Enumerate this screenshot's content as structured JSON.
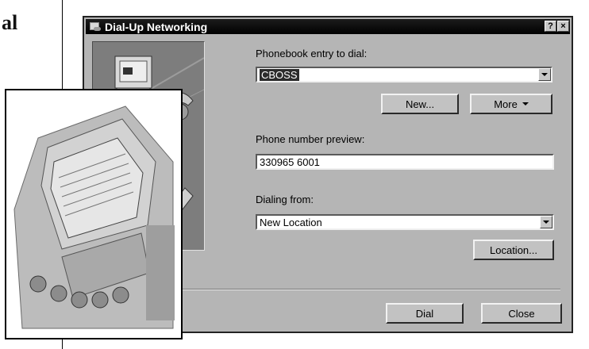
{
  "page": {
    "heading_fragment": "al"
  },
  "dialog": {
    "title": "Dial-Up Networking",
    "help_button": "?",
    "close_button": "×",
    "phonebook_label": "Phonebook entry to dial:",
    "phonebook_value": "CBOSS",
    "new_button": "New...",
    "more_button": "More",
    "phone_preview_label": "Phone number preview:",
    "phone_preview_value": "330965 6001",
    "dialing_from_label": "Dialing from:",
    "dialing_from_value": "New Location",
    "location_button": "Location...",
    "dial_button": "Dial",
    "close_dialog_button": "Close"
  },
  "colors": {
    "titlebar": "#000000",
    "dialog_face": "#b5b5b5",
    "selection": "#2b2b2b"
  },
  "icons": [
    "dialup-networking-icon",
    "computer-phone-illustration",
    "dropdown-arrow-icon"
  ]
}
